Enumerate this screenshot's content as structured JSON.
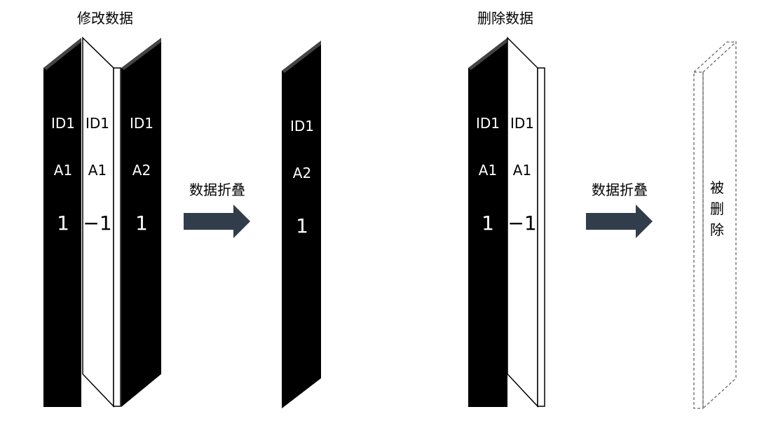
{
  "colors": {
    "black_block": "#000000",
    "block_top_edge": "#444444",
    "white_block": "#ffffff",
    "arrow": "#323d4b",
    "dashed_outline": "#666666"
  },
  "left_panel": {
    "title": "修改数据",
    "blocks": [
      {
        "style": "black",
        "id": "ID1",
        "attr": "A1",
        "value": "1"
      },
      {
        "style": "white",
        "id": "ID1",
        "attr": "A1",
        "value": "−1"
      },
      {
        "style": "black",
        "id": "ID1",
        "attr": "A2",
        "value": "1"
      }
    ],
    "arrow_label": "数据折叠",
    "result": {
      "style": "black",
      "id": "ID1",
      "attr": "A2",
      "value": "1"
    }
  },
  "right_panel": {
    "title": "删除数据",
    "blocks": [
      {
        "style": "black",
        "id": "ID1",
        "attr": "A1",
        "value": "1"
      },
      {
        "style": "white",
        "id": "ID1",
        "attr": "A1",
        "value": "−1"
      }
    ],
    "arrow_label": "数据折叠",
    "result": {
      "style": "dashed",
      "label_chars": [
        "被",
        "删",
        "除"
      ]
    }
  }
}
